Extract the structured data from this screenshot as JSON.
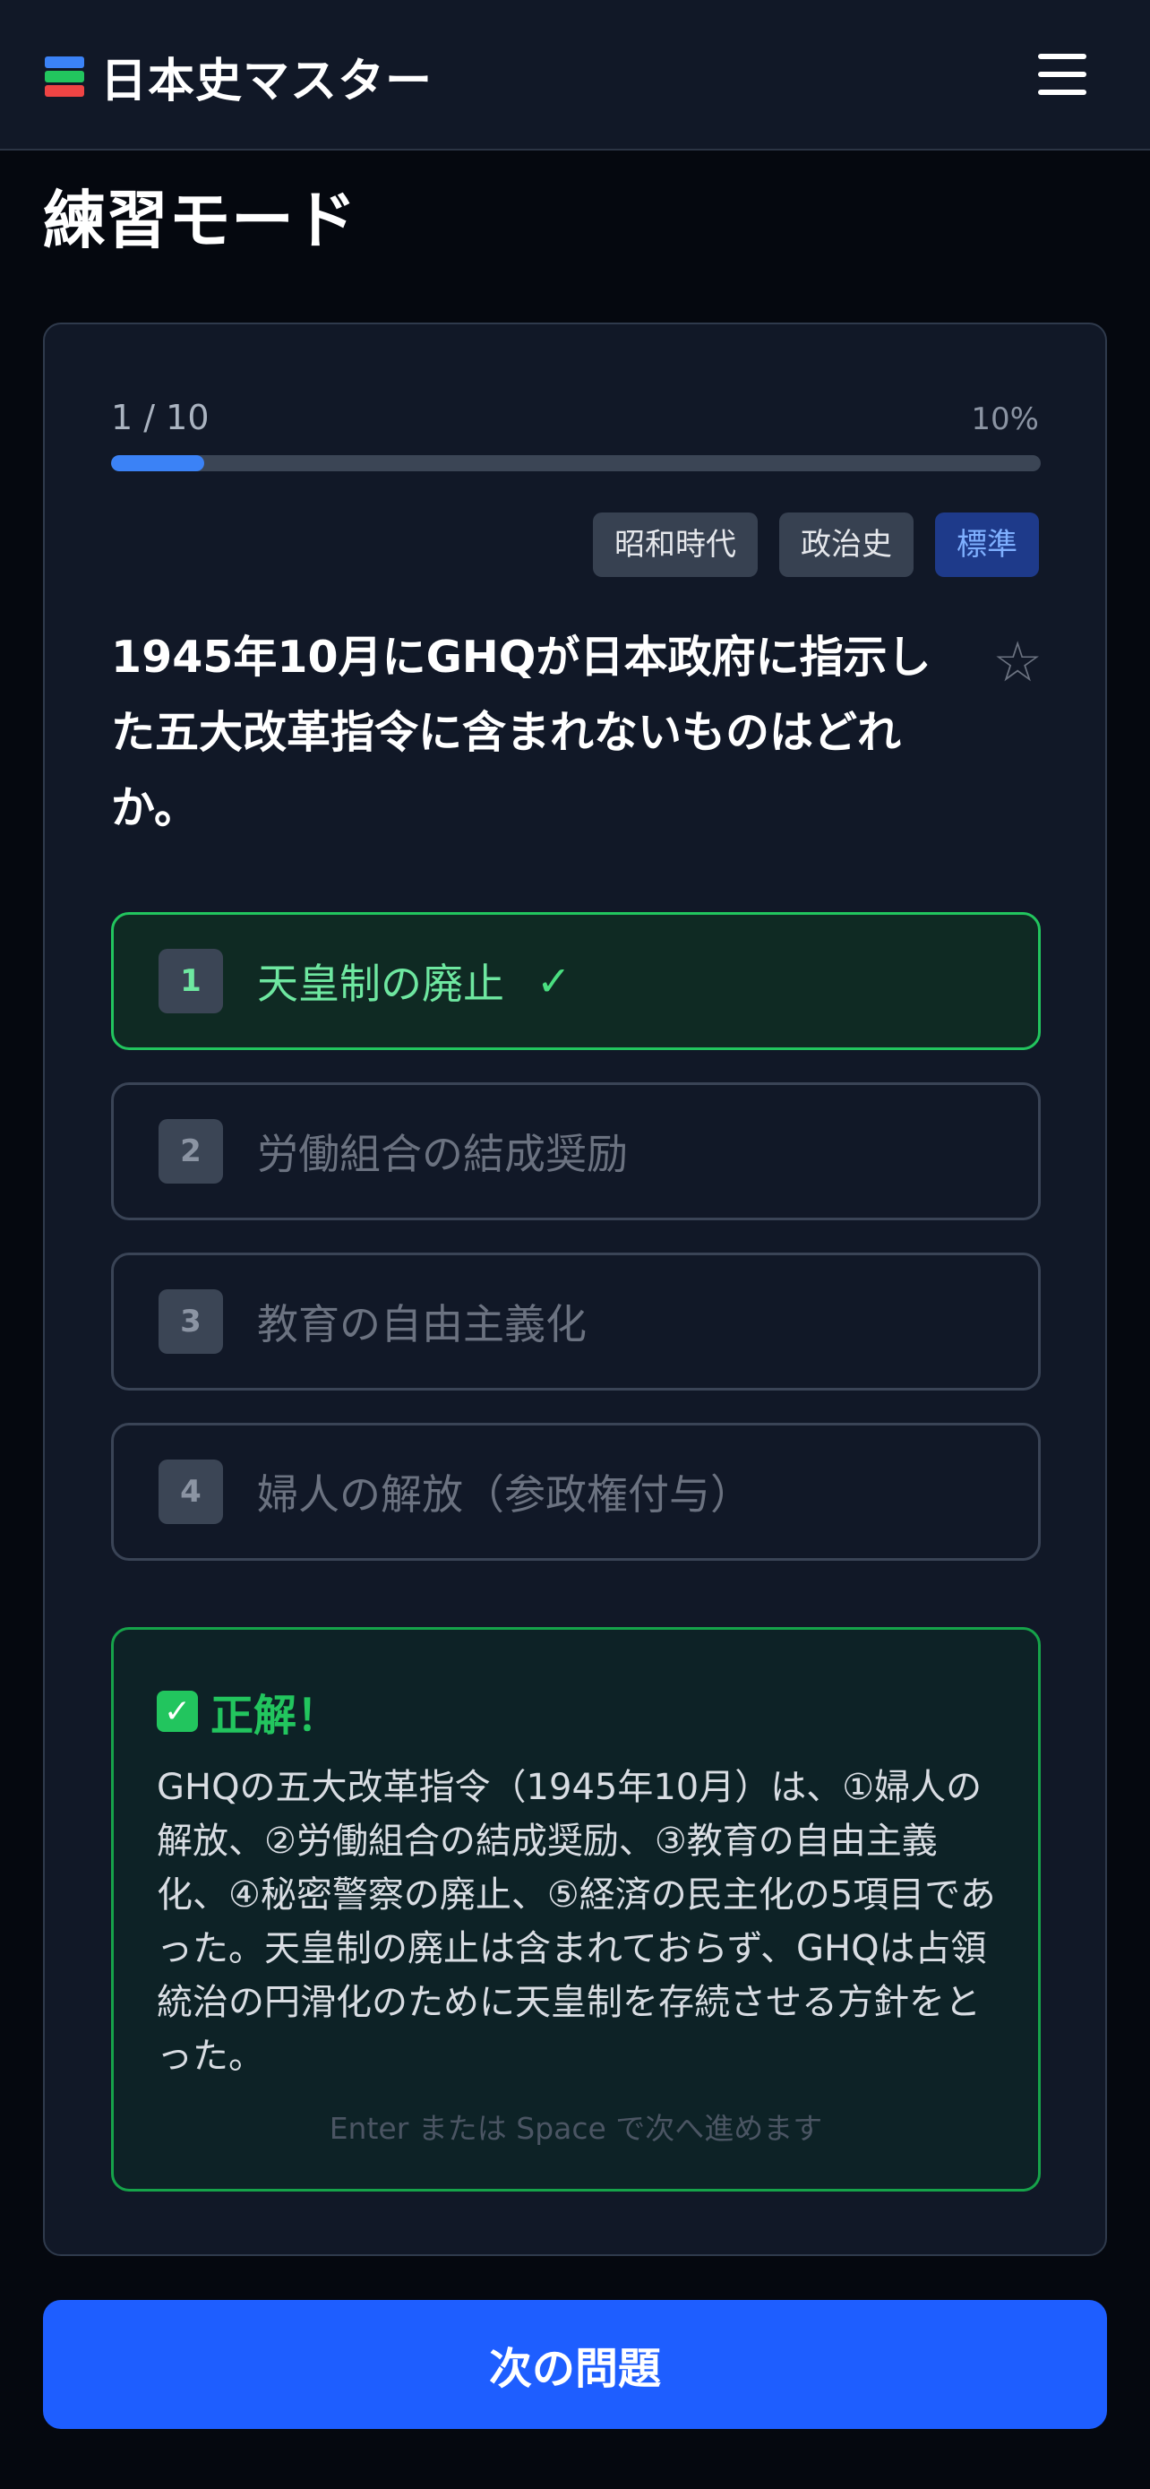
{
  "header": {
    "title": "日本史マスター",
    "brand_icon": "books-icon",
    "menu_icon": "hamburger-menu-icon"
  },
  "page": {
    "title": "練習モード"
  },
  "progress": {
    "count": "1 / 10",
    "percent": "10%",
    "fraction": 0.1,
    "color": "#3b82f6"
  },
  "tags": [
    "昭和時代",
    "政治史"
  ],
  "difficulty": "標準",
  "question": {
    "text": "1945年10月にGHQが日本政府に指示した五大改革指令に含まれないものはどれか。",
    "favorite_icon": "star-outline-icon"
  },
  "options": [
    {
      "num": "1",
      "text": "天皇制の廃止",
      "state": "correct",
      "mark": "✓"
    },
    {
      "num": "2",
      "text": "労働組合の結成奨励",
      "state": "normal"
    },
    {
      "num": "3",
      "text": "教育の自由主義化",
      "state": "normal"
    },
    {
      "num": "4",
      "text": "婦人の解放（参政権付与）",
      "state": "normal"
    }
  ],
  "feedback": {
    "icon": "✓",
    "label": "正解！",
    "text": "GHQの五大改革指令（1945年10月）は、①婦人の解放、②労働組合の結成奨励、③教育の自由主義化、④秘密警察の廃止、⑤経済の民主化の5項目であった。天皇制の廃止は含まれておらず、GHQは占領統治の円滑化のために天皇制を存続させる方針をとった。",
    "hint": "Enter または Space で次へ進めます",
    "accent": "#22c55e"
  },
  "next_button": "次の問題"
}
